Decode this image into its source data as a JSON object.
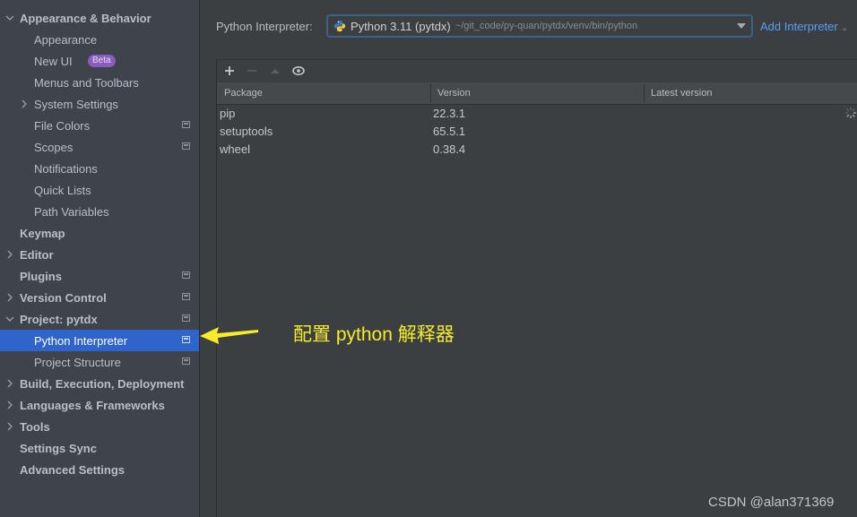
{
  "sidebar": {
    "items": [
      {
        "label": "Appearance & Behavior",
        "level": 0,
        "bold": true,
        "chevron": "expanded"
      },
      {
        "label": "Appearance",
        "level": 1
      },
      {
        "label": "New UI",
        "level": 1,
        "badge": "Beta"
      },
      {
        "label": "Menus and Toolbars",
        "level": 1
      },
      {
        "label": "System Settings",
        "level": 1,
        "chevron": "collapsed"
      },
      {
        "label": "File Colors",
        "level": 1,
        "project_icon": true
      },
      {
        "label": "Scopes",
        "level": 1,
        "project_icon": true
      },
      {
        "label": "Notifications",
        "level": 1
      },
      {
        "label": "Quick Lists",
        "level": 1
      },
      {
        "label": "Path Variables",
        "level": 1
      },
      {
        "label": "Keymap",
        "level": 0,
        "bold": true
      },
      {
        "label": "Editor",
        "level": 0,
        "bold": true,
        "chevron": "collapsed"
      },
      {
        "label": "Plugins",
        "level": 0,
        "bold": true,
        "project_icon": true
      },
      {
        "label": "Version Control",
        "level": 0,
        "bold": true,
        "chevron": "collapsed",
        "project_icon": true
      },
      {
        "label": "Project: pytdx",
        "level": 0,
        "bold": true,
        "chevron": "expanded",
        "project_icon": true
      },
      {
        "label": "Python Interpreter",
        "level": 1,
        "selected": true,
        "project_icon": true
      },
      {
        "label": "Project Structure",
        "level": 1,
        "project_icon": true
      },
      {
        "label": "Build, Execution, Deployment",
        "level": 0,
        "bold": true,
        "chevron": "collapsed"
      },
      {
        "label": "Languages & Frameworks",
        "level": 0,
        "bold": true,
        "chevron": "collapsed"
      },
      {
        "label": "Tools",
        "level": 0,
        "bold": true,
        "chevron": "collapsed"
      },
      {
        "label": "Settings Sync",
        "level": 0,
        "bold": true
      },
      {
        "label": "Advanced Settings",
        "level": 0,
        "bold": true
      }
    ]
  },
  "interpreter": {
    "label": "Python Interpreter:",
    "selected_name": "Python 3.11 (pytdx)",
    "selected_path": "~/git_code/py-quan/pytdx/venv/bin/python",
    "add_label": "Add Interpreter",
    "icon": "python-logo-icon"
  },
  "toolbar": {
    "add": "plus-icon",
    "remove": "minus-icon",
    "upgrade": "triangle-up-icon",
    "show_early": "eye-icon"
  },
  "packages": {
    "columns": [
      "Package",
      "Version",
      "Latest version"
    ],
    "rows": [
      {
        "package": "pip",
        "version": "22.3.1",
        "latest": ""
      },
      {
        "package": "setuptools",
        "version": "65.5.1",
        "latest": ""
      },
      {
        "package": "wheel",
        "version": "0.38.4",
        "latest": ""
      }
    ],
    "loading": true
  },
  "annotation": {
    "text": "配置 python 解释器",
    "color": "#f6ec2a"
  },
  "watermark": "CSDN @alan371369",
  "colors": {
    "selection": "#2f65ca",
    "link": "#589df6",
    "badge": "#8a5cc0"
  }
}
